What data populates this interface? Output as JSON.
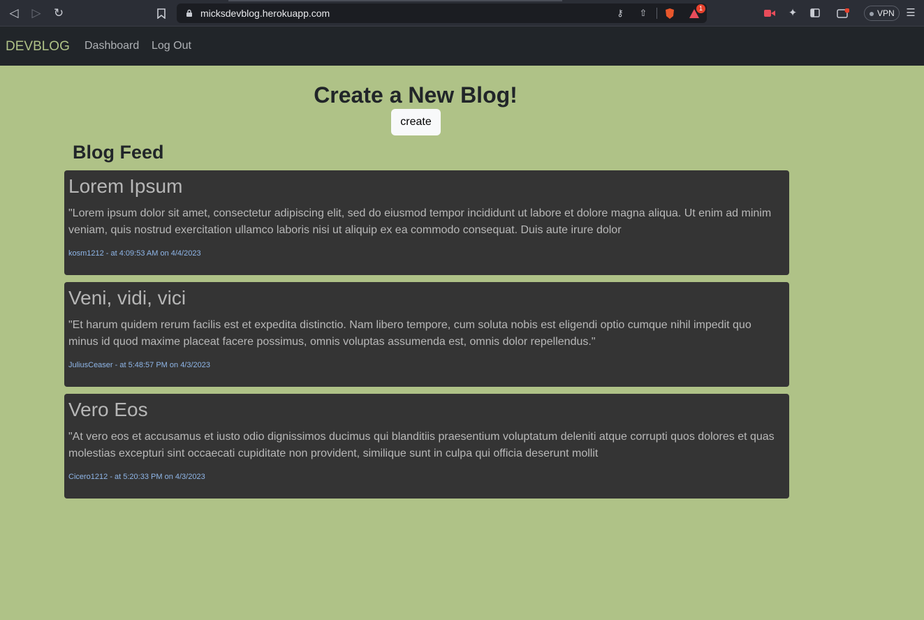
{
  "browser": {
    "url": "micksdevblog.herokuapp.com",
    "vpn_label": "VPN",
    "alert_count": "1"
  },
  "nav": {
    "brand": "DEVBLOG",
    "links": [
      "Dashboard",
      "Log Out"
    ]
  },
  "create": {
    "title": "Create a New Blog!",
    "button_label": "create"
  },
  "feed": {
    "title": "Blog Feed",
    "posts": [
      {
        "title": "Lorem Ipsum",
        "body": "\"Lorem ipsum dolor sit amet, consectetur adipiscing elit, sed do eiusmod tempor incididunt ut labore et dolore magna aliqua. Ut enim ad minim veniam, quis nostrud exercitation ullamco laboris nisi ut aliquip ex ea commodo consequat. Duis aute irure dolor",
        "meta": "kosm1212 - at 4:09:53 AM on 4/4/2023"
      },
      {
        "title": "Veni, vidi, vici",
        "body": "\"Et harum quidem rerum facilis est et expedita distinctio. Nam libero tempore, cum soluta nobis est eligendi optio cumque nihil impedit quo minus id quod maxime placeat facere possimus, omnis voluptas assumenda est, omnis dolor repellendus.\"",
        "meta": "JuliusCeaser - at 5:48:57 PM on 4/3/2023"
      },
      {
        "title": "Vero Eos",
        "body": "\"At vero eos et accusamus et iusto odio dignissimos ducimus qui blanditiis praesentium voluptatum deleniti atque corrupti quos dolores et quas molestias excepturi sint occaecati cupiditate non provident, similique sunt in culpa qui officia deserunt mollit",
        "meta": "Cicero1212 - at 5:20:33 PM on 4/3/2023"
      }
    ]
  }
}
